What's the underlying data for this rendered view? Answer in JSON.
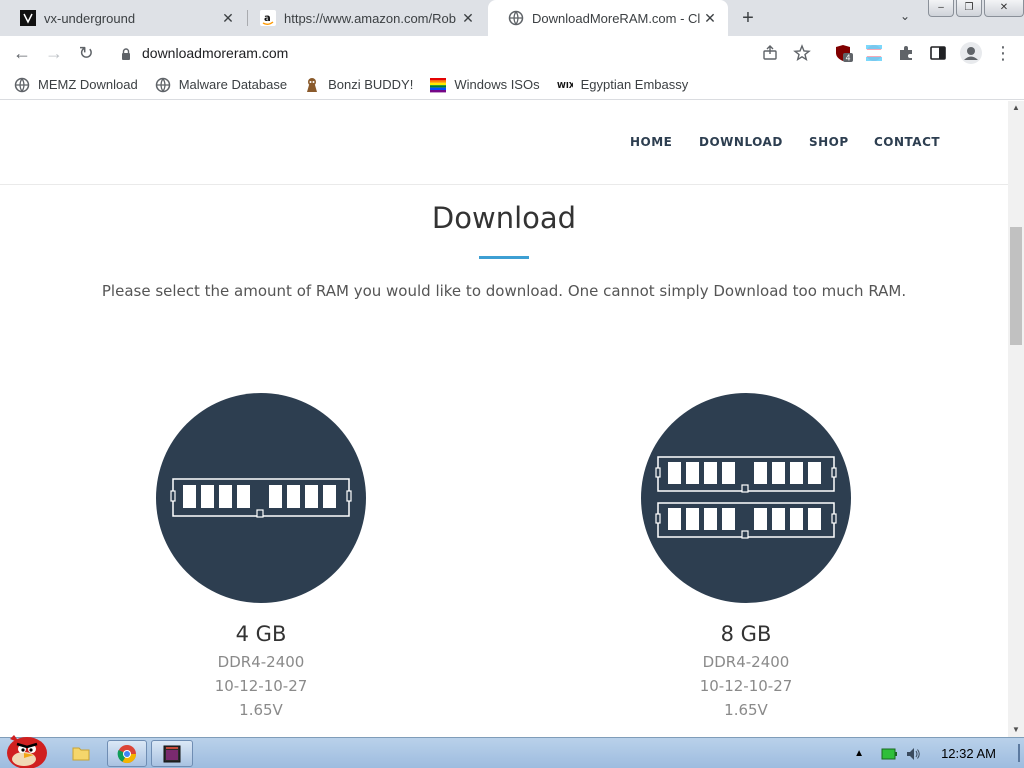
{
  "browser": {
    "tabs": [
      {
        "title": "vx-underground",
        "icon": "vx-logo-icon",
        "active": false
      },
      {
        "title": "https://www.amazon.com/Rob",
        "icon": "amazon-icon",
        "active": false
      },
      {
        "title": "DownloadMoreRAM.com - Cl",
        "icon": "globe-icon",
        "active": true
      }
    ],
    "new_tab_label": "+",
    "url": "downloadmoreram.com",
    "extension_badge": "4"
  },
  "bookmarks": [
    {
      "label": "MEMZ Download",
      "icon": "globe-icon"
    },
    {
      "label": "Malware Database",
      "icon": "globe-icon"
    },
    {
      "label": "Bonzi BUDDY!",
      "icon": "bonzi-icon"
    },
    {
      "label": "Windows ISOs",
      "icon": "rainbow-flag-icon"
    },
    {
      "label": "Egyptian Embassy",
      "icon": "wix-icon"
    }
  ],
  "site": {
    "nav": [
      "HOME",
      "DOWNLOAD",
      "SHOP",
      "CONTACT"
    ],
    "heading": "Download",
    "intro": "Please select the amount of RAM you would like to download. One cannot simply Download too much RAM.",
    "products": [
      {
        "name": "4 GB",
        "type": "DDR4-2400",
        "timings": "10-12-10-27",
        "voltage": "1.65V",
        "sticks": 1
      },
      {
        "name": "8 GB",
        "type": "DDR4-2400",
        "timings": "10-12-10-27",
        "voltage": "1.65V",
        "sticks": 2
      }
    ]
  },
  "taskbar": {
    "clock": "12:32 AM"
  },
  "colors": {
    "navy": "#2d3e50",
    "accent": "#3d9fd3"
  }
}
